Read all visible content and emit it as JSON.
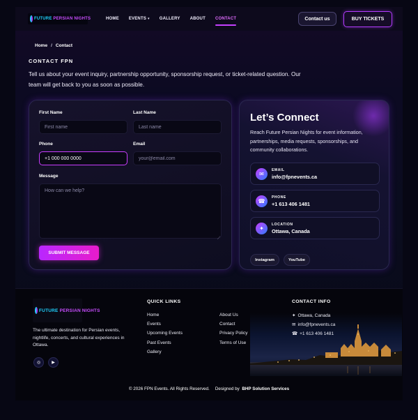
{
  "header": {
    "logo_text_1": "FUTURE",
    "logo_text_2": "PERSIAN NIGHTS",
    "nav": [
      {
        "label": "HOME"
      },
      {
        "label": "EVENTS"
      },
      {
        "label": "GALLERY"
      },
      {
        "label": "ABOUT"
      },
      {
        "label": "CONTACT",
        "active": true
      }
    ],
    "contact_button": "Contact us",
    "buy_button": "BUY TICKETS"
  },
  "breadcrumb": {
    "home": "Home",
    "separator": "/",
    "current": "Contact"
  },
  "hero": {
    "eyebrow": "CONTACT FPN",
    "intro": "Tell us about your event inquiry, partnership opportunity, sponsorship request, or ticket-related question. Our team will get back to you as soon as possible."
  },
  "form": {
    "first_name": {
      "label": "First Name",
      "placeholder": "First name",
      "value": ""
    },
    "last_name": {
      "label": "Last Name",
      "placeholder": "Last name",
      "value": ""
    },
    "phone": {
      "label": "Phone",
      "placeholder": "+1 000 000 0000",
      "value": "+1 000 000 0000"
    },
    "email": {
      "label": "Email",
      "placeholder": "your@email.com",
      "value": ""
    },
    "message": {
      "label": "Message",
      "placeholder": "How can we help?",
      "value": ""
    },
    "submit": "SUBMIT MESSAGE"
  },
  "connect": {
    "title": "Let’s Connect",
    "text": "Reach Future Persian Nights for event information, partnerships, media requests, sponsorships, and community collaborations.",
    "items": [
      {
        "icon": "mail-icon",
        "label": "EMAIL",
        "value": "info@fpnevents.ca"
      },
      {
        "icon": "phone-icon",
        "label": "PHONE",
        "value": "+1 613 406 1481"
      },
      {
        "icon": "location-icon",
        "label": "LOCATION",
        "value": "Ottawa, Canada"
      }
    ],
    "socials": [
      "Instagram",
      "YouTube"
    ]
  },
  "footer": {
    "logo_text_1": "FUTURE",
    "logo_text_2": "PERSIAN NIGHTS",
    "description": "The ultimate destination for Persian events, nightlife, concerts, and cultural experiences in Ottawa.",
    "quick_links_title": "QUICK LINKS",
    "links_col1": [
      "Home",
      "Events",
      "Upcoming Events",
      "Past Events",
      "Gallery"
    ],
    "links_col2": [
      "About Us",
      "Contact",
      "Privacy Policy",
      "Terms of Use"
    ],
    "contact_title": "CONTACT INFO",
    "contact_lines": [
      {
        "icon": "location-icon",
        "text": "Ottawa, Canada"
      },
      {
        "icon": "mail-icon",
        "text": "info@fpnevents.ca"
      },
      {
        "icon": "phone-icon",
        "text": "+1 613 406 1481"
      }
    ],
    "copyright": "© 2026 FPN Events. All Rights Reserved.",
    "designed_by_label": "Designed by",
    "designed_by": "BHP Solution Services"
  },
  "colors": {
    "accent": "#c540ff",
    "accent_pink": "#e81bcb",
    "logo_cyan": "#1fd2ff",
    "background": "#070714"
  }
}
